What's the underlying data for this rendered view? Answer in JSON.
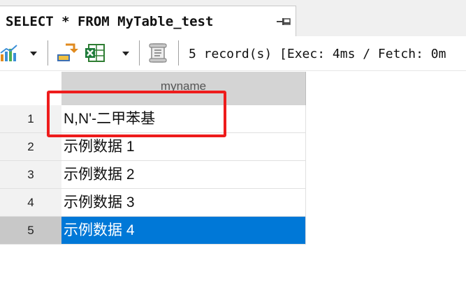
{
  "tab": {
    "title": "SELECT * FROM MyTable_test",
    "pin_icon": "pin-icon"
  },
  "toolbar": {
    "icons": [
      "chart-icon",
      "chevron-down-icon",
      "import-icon",
      "excel-export-icon",
      "chevron-down-icon",
      "script-icon"
    ],
    "status": "5 record(s) [Exec: 4ms / Fetch: 0m"
  },
  "grid": {
    "columns": [
      "myname"
    ],
    "rows": [
      {
        "num": "1",
        "value": "N,N'-二甲苯基"
      },
      {
        "num": "2",
        "value": "示例数据 1"
      },
      {
        "num": "3",
        "value": "示例数据 2"
      },
      {
        "num": "4",
        "value": "示例数据 3"
      },
      {
        "num": "5",
        "value": "示例数据 4"
      }
    ],
    "selected_row": 5
  },
  "colors": {
    "selection": "#0078d7",
    "annotation": "#ee1c1c",
    "header": "#d4d4d4"
  }
}
